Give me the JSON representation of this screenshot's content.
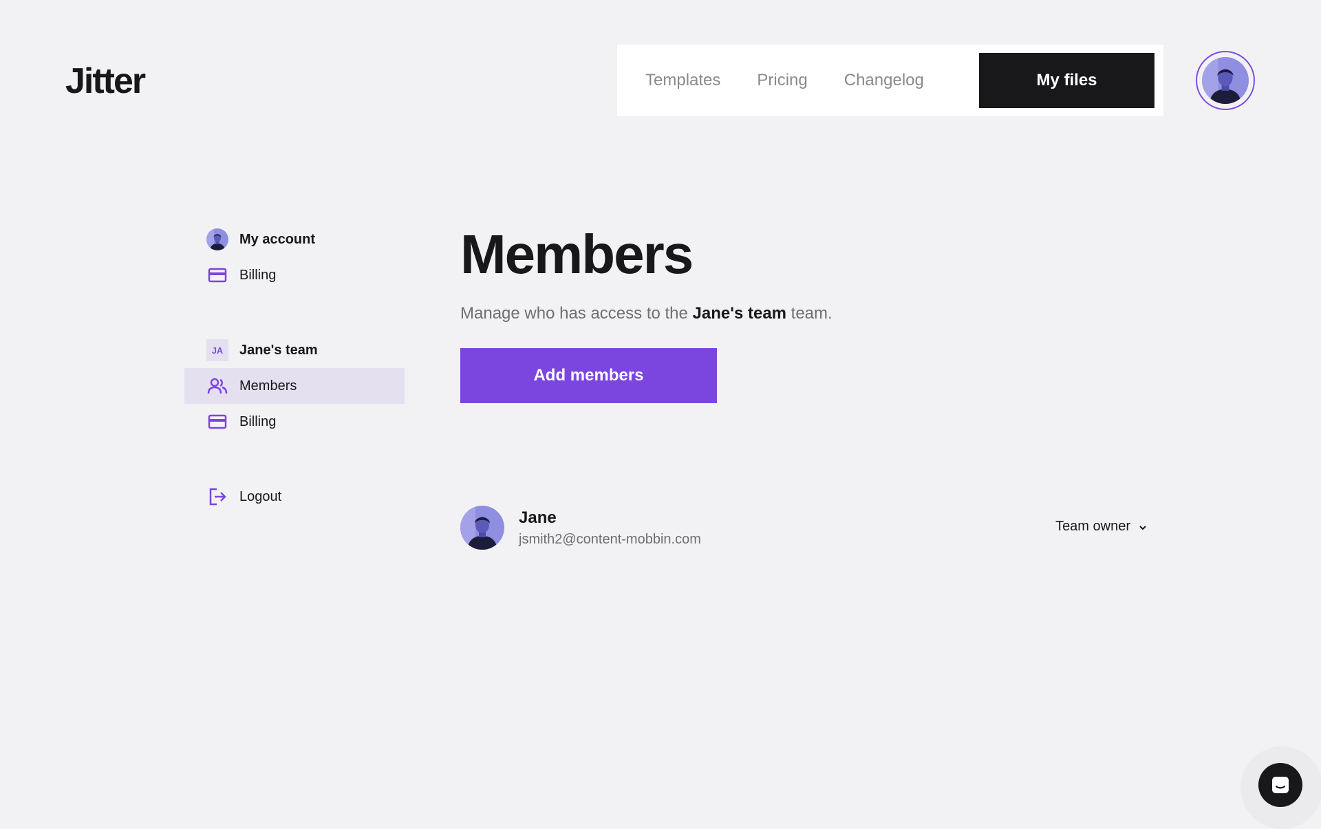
{
  "brand": {
    "logo_text": "Jitter"
  },
  "topnav": {
    "links": [
      "Templates",
      "Pricing",
      "Changelog"
    ],
    "primary_button": "My files"
  },
  "sidebar": {
    "account": [
      {
        "label": "My account",
        "icon": "user-avatar-icon"
      },
      {
        "label": "Billing",
        "icon": "credit-card-icon"
      }
    ],
    "team": {
      "badge": "JA",
      "name": "Jane's team",
      "items": [
        {
          "label": "Members",
          "icon": "users-icon",
          "active": true
        },
        {
          "label": "Billing",
          "icon": "credit-card-icon",
          "active": false
        }
      ]
    },
    "logout": {
      "label": "Logout",
      "icon": "logout-icon"
    }
  },
  "main": {
    "title": "Members",
    "subtitle_prefix": "Manage who has access to the ",
    "subtitle_team": "Jane's team",
    "subtitle_suffix": " team.",
    "add_button": "Add members",
    "members": [
      {
        "name": "Jane",
        "email": "jsmith2@content-mobbin.com",
        "role": "Team owner"
      }
    ]
  },
  "colors": {
    "accent": "#7b45e0",
    "dark": "#18181b",
    "background": "#f2f2f4",
    "active_bg": "#e5e0f0"
  }
}
